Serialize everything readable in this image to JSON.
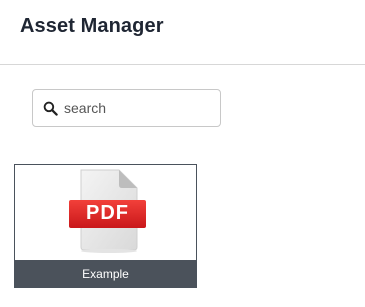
{
  "header": {
    "title": "Asset Manager"
  },
  "search": {
    "placeholder": "search",
    "value": ""
  },
  "assets": [
    {
      "name": "Example",
      "file_type_label": "PDF",
      "icon": "pdf-file-icon"
    }
  ],
  "colors": {
    "caption_bg": "#4b525b",
    "pdf_badge": "#e52b27",
    "title_text": "#1f2633"
  }
}
